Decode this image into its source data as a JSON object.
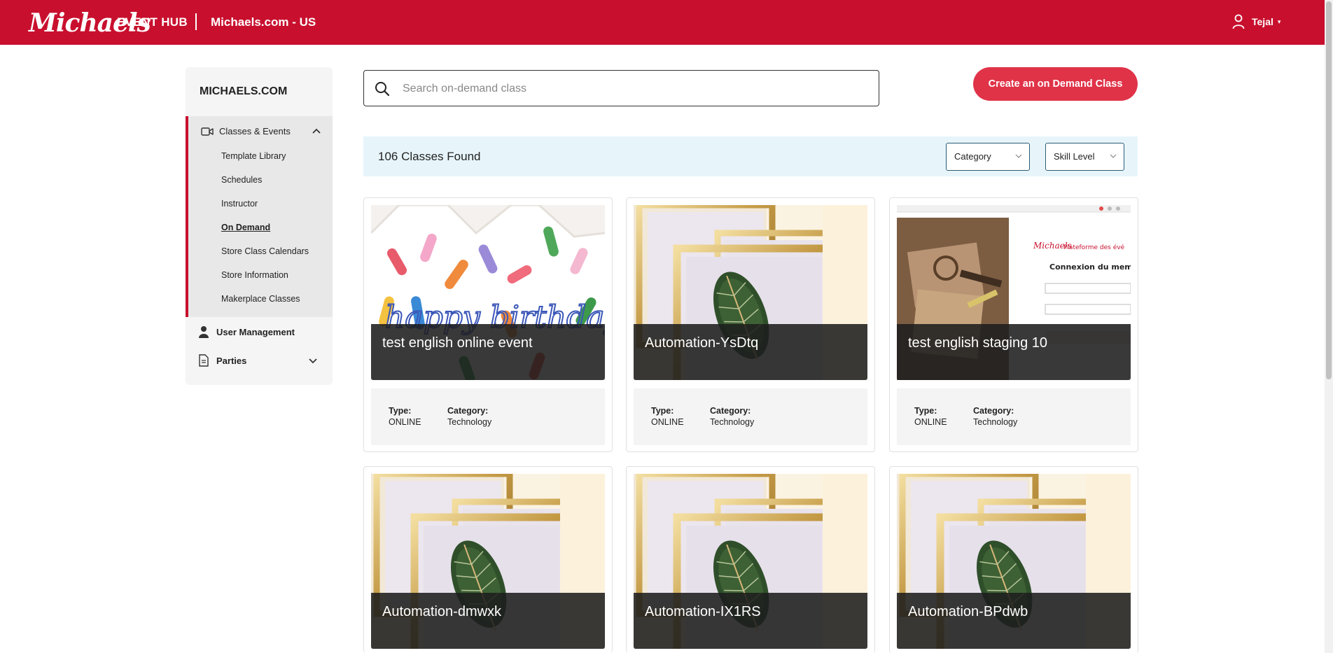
{
  "header": {
    "logo": "Michaels",
    "app_name": "EVENT HUB",
    "site": "Michaels.com - US",
    "user_name": "Tejal",
    "colors": {
      "brand": "#c8102e"
    }
  },
  "sidebar": {
    "title": "MICHAELS.COM",
    "group_label": "Classes & Events",
    "items": [
      {
        "label": "Template Library"
      },
      {
        "label": "Schedules"
      },
      {
        "label": "Instructor"
      },
      {
        "label": "On Demand",
        "active": true
      },
      {
        "label": "Store Class Calendars"
      },
      {
        "label": "Store Information"
      },
      {
        "label": "Makerplace Classes"
      }
    ],
    "user_management": "User Management",
    "parties": "Parties"
  },
  "search": {
    "placeholder": "Search on-demand class",
    "value": ""
  },
  "create_button": "Create an on Demand Class",
  "results": {
    "count_text": "106 Classes Found",
    "filters": [
      {
        "label": "Category"
      },
      {
        "label": "Skill Level"
      }
    ]
  },
  "cards": [
    {
      "title": "test english online event",
      "image": "birthday-crown",
      "type_label": "Type:",
      "type": "ONLINE",
      "category_label": "Category:",
      "category": "Technology"
    },
    {
      "title": "Automation-YsDtq",
      "image": "gold-frames",
      "type_label": "Type:",
      "type": "ONLINE",
      "category_label": "Category:",
      "category": "Technology"
    },
    {
      "title": "test english staging 10",
      "image": "login-screenshot",
      "type_label": "Type:",
      "type": "ONLINE",
      "category_label": "Category:",
      "category": "Technology"
    },
    {
      "title": "Automation-dmwxk",
      "image": "gold-frames"
    },
    {
      "title": "Automation-IX1RS",
      "image": "gold-frames"
    },
    {
      "title": "Automation-BPdwb",
      "image": "gold-frames"
    }
  ]
}
